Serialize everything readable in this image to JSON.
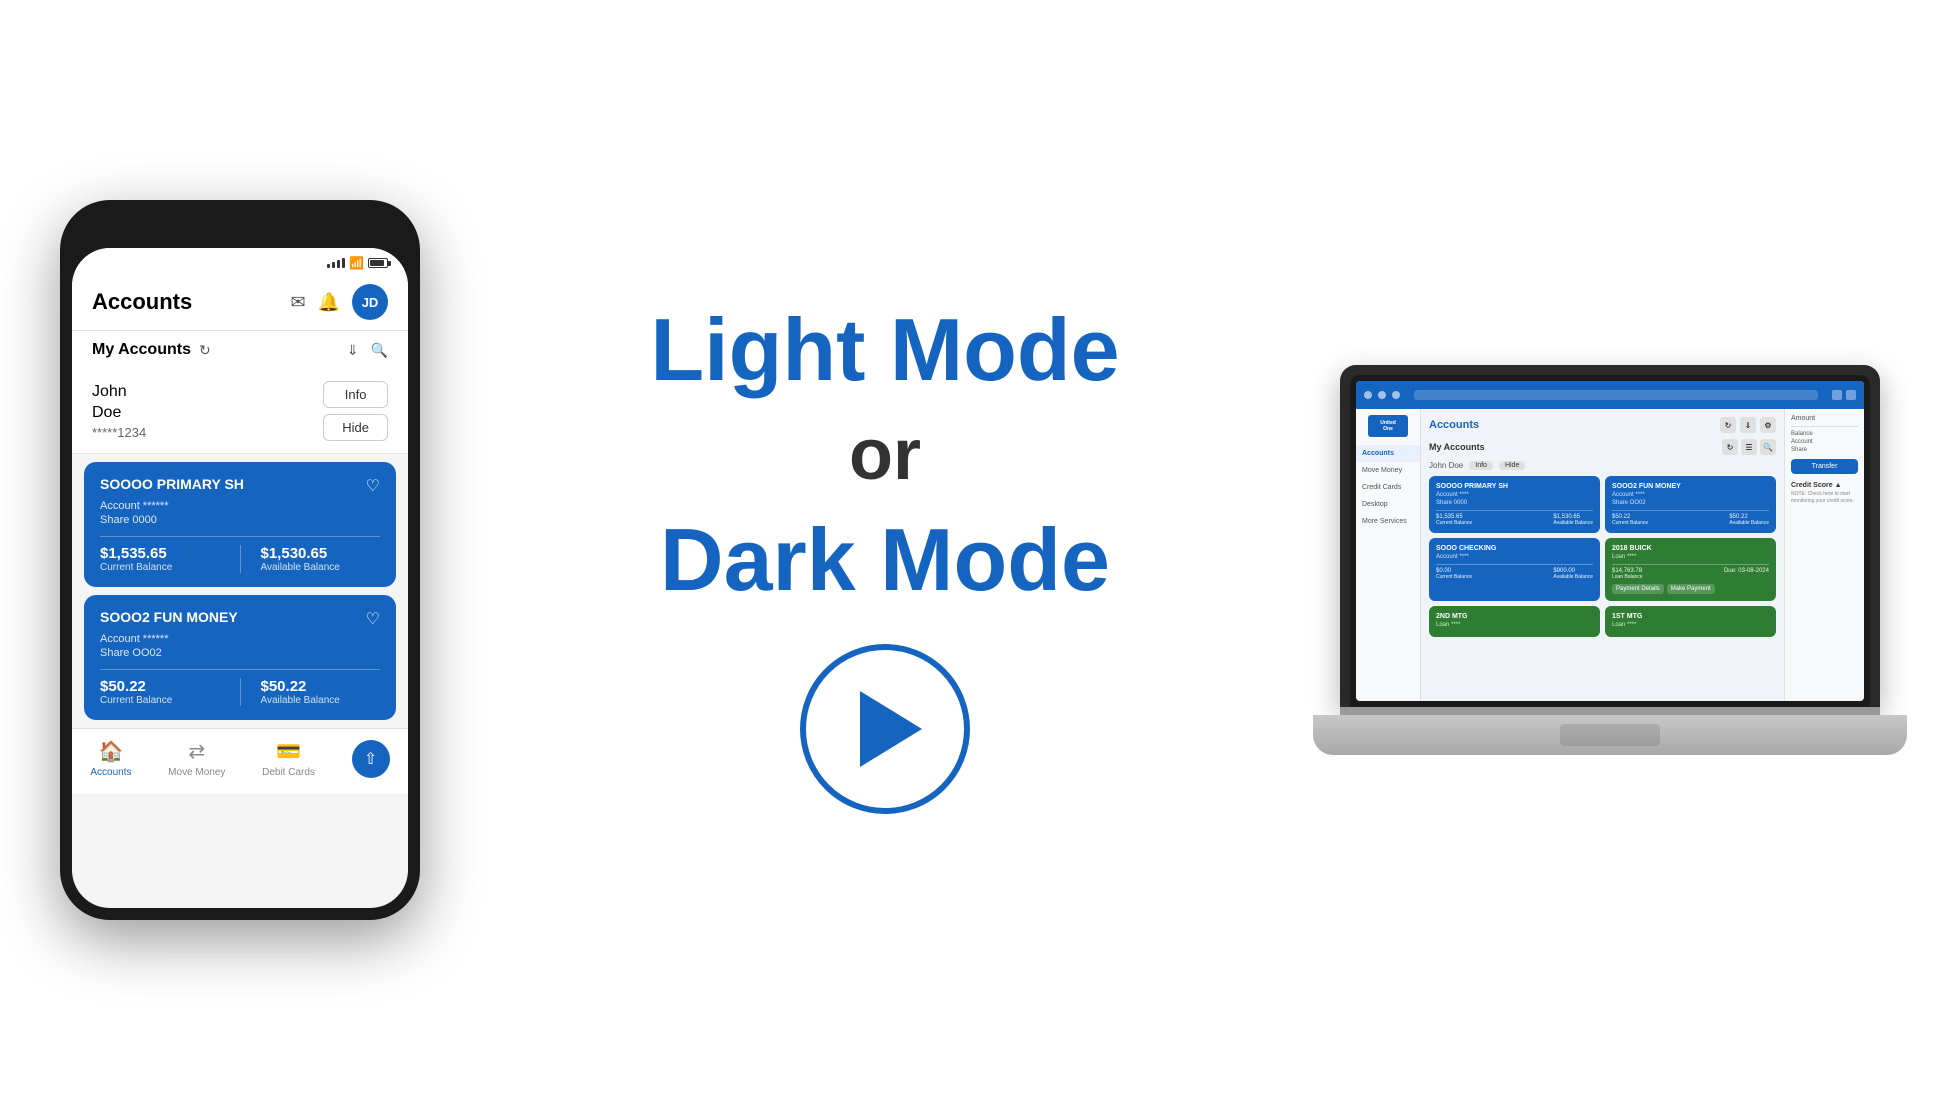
{
  "page": {
    "background": "#ffffff"
  },
  "phone": {
    "header_title": "Accounts",
    "avatar_initials": "JD",
    "subheader_title": "My Accounts",
    "user_name_line1": "John",
    "user_name_line2": "Doe",
    "user_account_number": "*****1234",
    "btn_info": "Info",
    "btn_hide": "Hide",
    "card1_title": "SOOOO PRIMARY SH",
    "card1_account": "Account ******",
    "card1_share": "Share 0000",
    "card1_current_balance": "$1,535.65",
    "card1_current_label": "Current Balance",
    "card1_available_balance": "$1,530.65",
    "card1_available_label": "Available Balance",
    "card2_title": "SOOO2 FUN MONEY",
    "card2_account": "Account ******",
    "card2_share": "Share OO02",
    "card2_current_balance": "$50.22",
    "card2_current_label": "Current Balance",
    "card2_available_balance": "$50.22",
    "card2_available_label": "Available Balance",
    "nav_accounts": "Accounts",
    "nav_move_money": "Move Money",
    "nav_debit_cards": "Debit Cards"
  },
  "center": {
    "title_line1": "Light Mode",
    "or_text": "or",
    "title_line2": "Dark Mode",
    "play_button_label": "Play video"
  },
  "laptop": {
    "sidebar_items": [
      {
        "label": "Accounts",
        "active": true
      },
      {
        "label": "Move Money",
        "active": false
      },
      {
        "label": "Credit Cards",
        "active": false
      },
      {
        "label": "Desktop",
        "active": false
      },
      {
        "label": "More Services",
        "active": false
      }
    ],
    "main_title": "Accounts",
    "sub_title": "My Accounts",
    "user_name": "John Doe",
    "card1_title": "SOOOO PRIMARY SH",
    "card2_title": "SOOO2 FUN MONEY",
    "card3_title": "SOOO CHECKING",
    "card4_title": "2018 BUICK",
    "card5_title": "2ND MTG",
    "card6_title": "1ST MTG",
    "transfer_btn": "Transfer",
    "right_panel_title": "Amount",
    "logo_text": "UnitedOne"
  }
}
